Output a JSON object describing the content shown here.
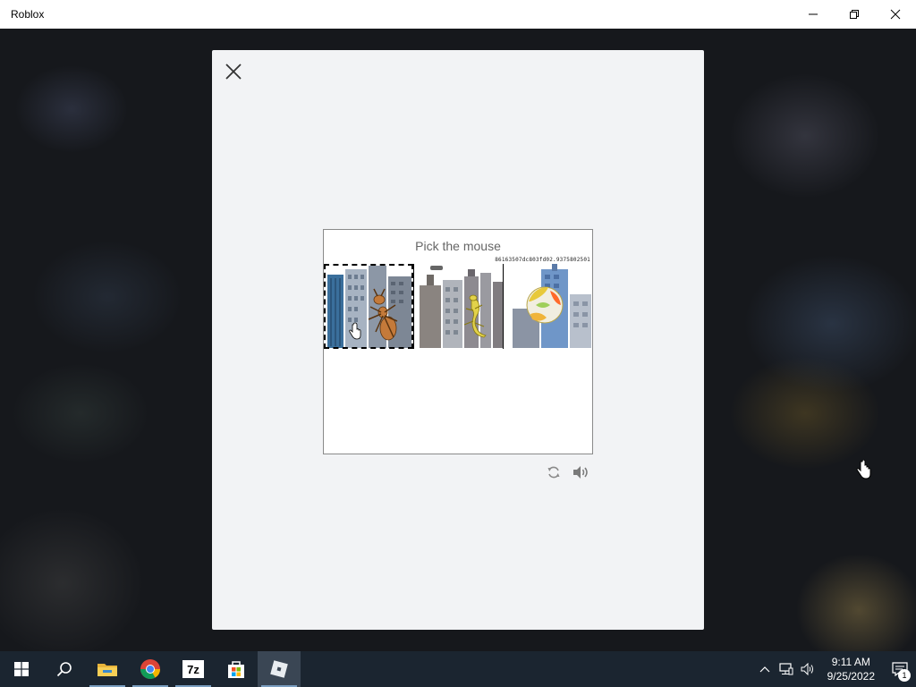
{
  "window": {
    "title": "Roblox",
    "minimize_icon": "minimize-icon",
    "restore_icon": "restore-icon",
    "close_icon": "close-icon"
  },
  "modal": {
    "close_icon": "close-icon"
  },
  "captcha": {
    "prompt": "Pick the mouse",
    "token": "86163507dc803fd02.9375802501",
    "tiles": [
      {
        "subject": "ant on skyscrapers",
        "selected": true
      },
      {
        "subject": "lizard on skyscrapers",
        "selected": false
      },
      {
        "subject": "ball on skyscrapers",
        "selected": false
      }
    ],
    "reload_icon": "reload-icon",
    "audio_icon": "speaker-icon"
  },
  "taskbar": {
    "apps": [
      {
        "icon": "windows-start-icon"
      },
      {
        "icon": "search-icon"
      },
      {
        "icon": "file-explorer-icon"
      },
      {
        "icon": "chrome-icon"
      },
      {
        "icon": "7zip-icon",
        "label": "7z"
      },
      {
        "icon": "microsoft-store-icon"
      },
      {
        "icon": "roblox-icon"
      }
    ],
    "tray": {
      "time": "9:11 AM",
      "date": "9/25/2022",
      "notification_count": "1"
    }
  }
}
